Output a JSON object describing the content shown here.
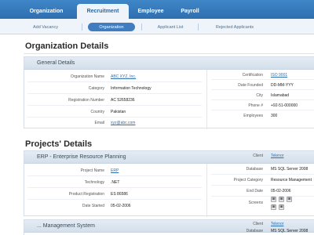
{
  "tabs": [
    {
      "label": "Organization"
    },
    {
      "label": "Recruitment"
    },
    {
      "label": "Employee"
    },
    {
      "label": "Payroll"
    }
  ],
  "subnav": [
    {
      "label": "Add Vacancy"
    },
    {
      "label": "Organization"
    },
    {
      "label": "Applicant List"
    },
    {
      "label": "Rejected Applicants"
    }
  ],
  "org": {
    "title": "Organization Details",
    "general_title": "General Details",
    "left": [
      {
        "label": "Organization Name",
        "value": "ABC XYZ, Inc."
      },
      {
        "label": "Category",
        "value": "Information Technology"
      },
      {
        "label": "Registration Number",
        "value": "AC 52658236"
      },
      {
        "label": "Country",
        "value": "Pakistan"
      },
      {
        "label": "Email",
        "value": "xyz@abc.com"
      }
    ],
    "right": [
      {
        "label": "Certification",
        "value": "ISO 9001"
      },
      {
        "label": "Date Founded",
        "value": "DD-MM-YYY"
      },
      {
        "label": "City",
        "value": "Islamabad"
      },
      {
        "label": "Phone #",
        "value": "+92-51-000000"
      },
      {
        "label": "Employees",
        "value": "300"
      }
    ]
  },
  "projects": {
    "title": "Projects' Details",
    "erp_title": "ERP - Enterprise Resource Planning",
    "left": [
      {
        "label": "Project Name",
        "value": "ERP"
      },
      {
        "label": "Technology",
        "value": ".NET"
      },
      {
        "label": "Product Registration",
        "value": "ES 86586"
      },
      {
        "label": "Date Started",
        "value": "05-02-2006"
      }
    ],
    "right": [
      {
        "label": "Client",
        "value": "Telenor"
      },
      {
        "label": "Database",
        "value": "MS SQL Server 2008"
      },
      {
        "label": "Project Category",
        "value": "Resource Management"
      },
      {
        "label": "End Date",
        "value": "05-02-2006"
      },
      {
        "label": "Screens",
        "value": ""
      }
    ],
    "second_title": "... Management System",
    "second_right": [
      {
        "label": "Client",
        "value": "Telenor"
      },
      {
        "label": "Database",
        "value": "MS SQL Server 2008"
      }
    ]
  }
}
